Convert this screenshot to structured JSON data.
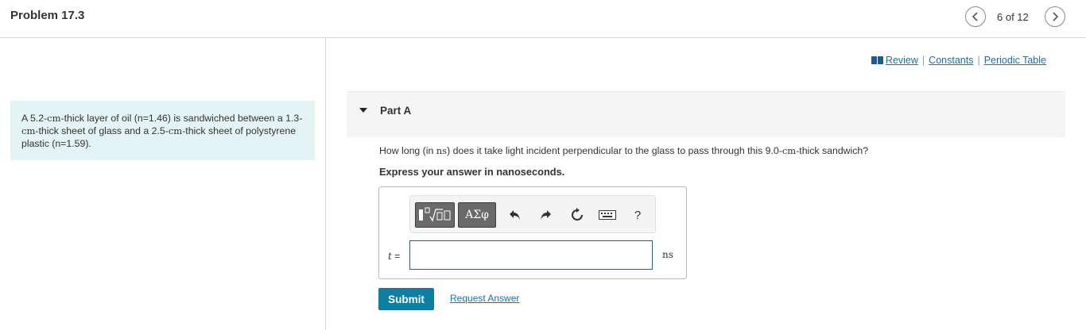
{
  "header": {
    "title": "Problem 17.3",
    "page_indicator": "6 of 12",
    "prev_icon": "chevron-left-icon",
    "next_icon": "chevron-right-icon"
  },
  "problem": {
    "text_1": "A 5.2-",
    "unit_1": "cm",
    "text_2": "-thick layer of oil (n=1.46) is sandwiched between a 1.3-",
    "unit_2": "cm",
    "text_3": "-thick sheet of glass and a 2.5-",
    "unit_3": "cm",
    "text_4": "-thick sheet of polystyrene plastic (n=1.59)."
  },
  "links": {
    "review": "Review",
    "separator": "|",
    "constants": "Constants",
    "periodic_table": "Periodic Table",
    "icon": "book-icon"
  },
  "part": {
    "label": "Part A",
    "question_1": "How long (in ",
    "question_unit_1": "ns",
    "question_2": ") does it take light incident perpendicular to the glass to pass through this 9.0-",
    "question_unit_2": "cm",
    "question_3": "-thick sandwich?",
    "instruction": "Express your answer in nanoseconds."
  },
  "toolbar": {
    "symbols_label": "ΑΣφ",
    "help_label": "?",
    "icons": [
      "templates-icon",
      "undo-icon",
      "redo-icon",
      "reset-icon",
      "keyboard-icon",
      "help-icon"
    ]
  },
  "answer": {
    "variable": "t",
    "equals": " =",
    "value": "",
    "unit": "ns"
  },
  "actions": {
    "submit_label": "Submit",
    "request_label": "Request Answer"
  },
  "colors": {
    "accent": "#0c7fa3",
    "link": "#1b6fa8",
    "problem_bg": "#e4f3f3",
    "part_bg": "#f5f5f5"
  }
}
